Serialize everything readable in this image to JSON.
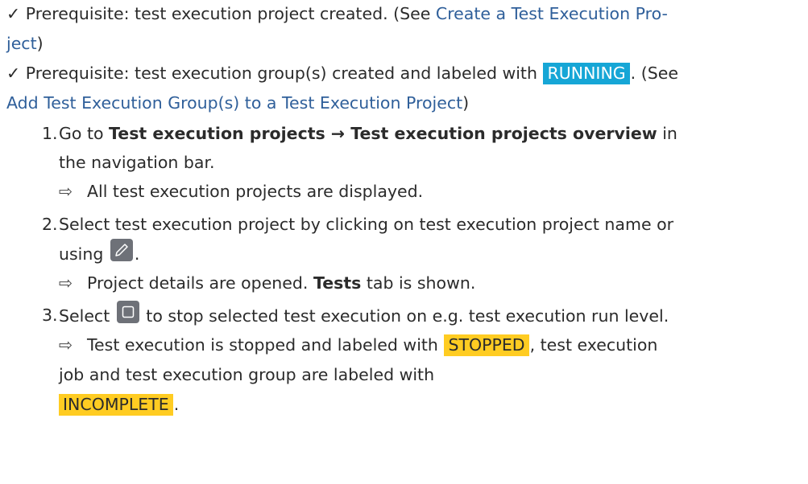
{
  "prereq1": {
    "check": "✓",
    "text": " Prerequisite: test execution project created. (See ",
    "link_part1": "Create a Test Execution Pro-",
    "link_part2": "ject",
    "tail": ")"
  },
  "prereq2": {
    "check": "✓",
    "text": " Prerequisite: test execution group(s) created and labeled with ",
    "badge": "RUNNING",
    "text2": ". (See",
    "link": "Add Test Execution Group(s) to a Test Execution Project",
    "tail": ")"
  },
  "steps": [
    {
      "number": "1.",
      "pre": "Go to ",
      "bold1": "Test execution projects",
      "arrow": " → ",
      "bold2": "Test execution projects overview",
      "post": " in",
      "line2": "the navigation bar.",
      "result_arrow": "⇨",
      "result": "All test execution projects are displayed."
    },
    {
      "number": "2.",
      "line1": "Select test execution project by clicking on test execution project name or",
      "line2_pre": "using",
      "line2_post": ".",
      "icon": "pencil-edit-icon",
      "result_arrow": "⇨",
      "result_pre": "Project details are opened. ",
      "result_bold": "Tests",
      "result_post": " tab is shown."
    },
    {
      "number": "3.",
      "pre": "Select",
      "icon": "stop-square-icon",
      "post": " to stop selected test execution on e.g. test execution run level.",
      "result_arrow": "⇨",
      "result_pre": "Test execution is stopped and labeled with ",
      "badge1": "STOPPED",
      "result_mid": ", test execution",
      "result_line2": "job and test execution group are labeled with",
      "badge2": "INCOMPLETE",
      "result_end": "."
    }
  ],
  "colors": {
    "link": "#2f5f9a",
    "badge_running": "#16a6d6",
    "badge_warning": "#ffcc22",
    "icon_bg": "#6e7178"
  }
}
